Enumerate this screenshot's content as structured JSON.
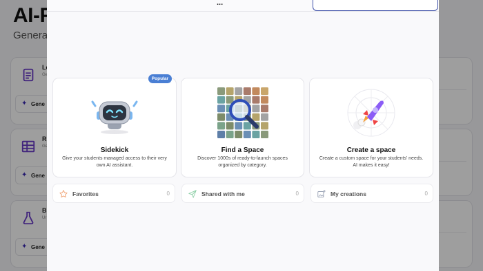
{
  "background": {
    "title": "AI-P",
    "subtitle": "Generat",
    "cards": [
      {
        "title": "Le",
        "subtitle": "Ge",
        "generate": "Gene"
      },
      {
        "title": "Ru",
        "subtitle": "Ge",
        "generate": "Gene"
      },
      {
        "title": "Bi",
        "subtitle": "Ur",
        "generate": "Gene"
      }
    ]
  },
  "modal": {
    "title": "...",
    "options": [
      {
        "name": "Sidekick",
        "description": "Give your students managed access to their very own AI assistant.",
        "badge": "Popular"
      },
      {
        "name": "Find a Space",
        "description": "Discover 1000s of ready-to-launch spaces organized by category."
      },
      {
        "name": "Create a space",
        "description": "Create a custom space for your students' needs. AI makes it easy!"
      }
    ],
    "collections": [
      {
        "label": "Favorites",
        "count": "0"
      },
      {
        "label": "Shared with me",
        "count": "0"
      },
      {
        "label": "My creations",
        "count": "0"
      }
    ]
  },
  "colors": {
    "accent": "#3d4fa8",
    "badge": "#4a7fd4",
    "overlay": "rgba(0,0,0,0.38)"
  }
}
